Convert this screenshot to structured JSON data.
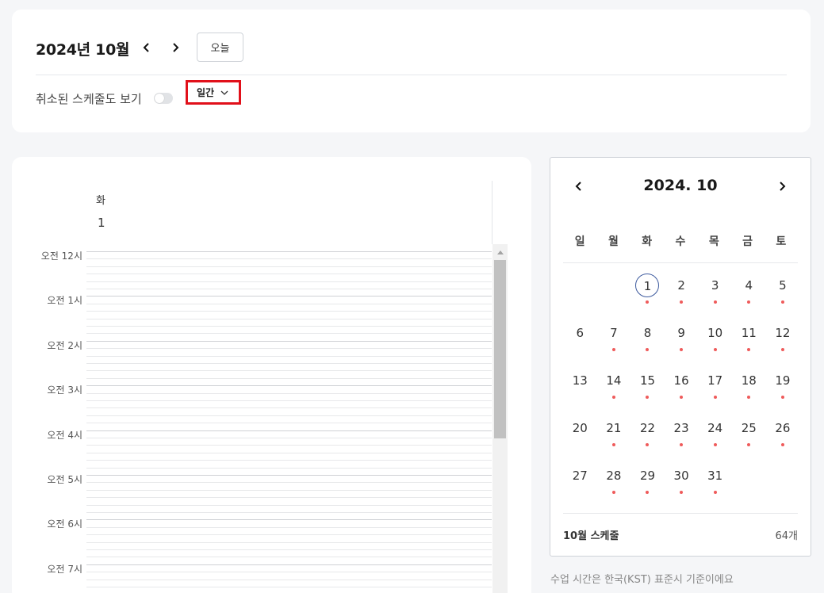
{
  "header": {
    "month_title": "2024년 10월",
    "today_label": "오늘",
    "show_cancelled_label": "취소된 스케줄도 보기",
    "view_select_value": "일간"
  },
  "day_view": {
    "weekday": "화",
    "date": "1",
    "time_labels": [
      "오전 12시",
      "오전 1시",
      "오전 2시",
      "오전 3시",
      "오전 4시",
      "오전 5시",
      "오전 6시",
      "오전 7시"
    ]
  },
  "mini_calendar": {
    "title": "2024. 10",
    "weekdays": [
      "일",
      "월",
      "화",
      "수",
      "목",
      "금",
      "토"
    ],
    "first_weekday_index": 2,
    "days": [
      {
        "d": "1",
        "dot": true,
        "today": true
      },
      {
        "d": "2",
        "dot": true
      },
      {
        "d": "3",
        "dot": true
      },
      {
        "d": "4",
        "dot": true
      },
      {
        "d": "5",
        "dot": true
      },
      {
        "d": "6",
        "dot": false
      },
      {
        "d": "7",
        "dot": true
      },
      {
        "d": "8",
        "dot": true
      },
      {
        "d": "9",
        "dot": true
      },
      {
        "d": "10",
        "dot": true
      },
      {
        "d": "11",
        "dot": true
      },
      {
        "d": "12",
        "dot": true
      },
      {
        "d": "13",
        "dot": false
      },
      {
        "d": "14",
        "dot": true
      },
      {
        "d": "15",
        "dot": true
      },
      {
        "d": "16",
        "dot": true
      },
      {
        "d": "17",
        "dot": true
      },
      {
        "d": "18",
        "dot": true
      },
      {
        "d": "19",
        "dot": true
      },
      {
        "d": "20",
        "dot": false
      },
      {
        "d": "21",
        "dot": true
      },
      {
        "d": "22",
        "dot": true
      },
      {
        "d": "23",
        "dot": true
      },
      {
        "d": "24",
        "dot": true
      },
      {
        "d": "25",
        "dot": true
      },
      {
        "d": "26",
        "dot": true
      },
      {
        "d": "27",
        "dot": false
      },
      {
        "d": "28",
        "dot": true
      },
      {
        "d": "29",
        "dot": true
      },
      {
        "d": "30",
        "dot": true
      },
      {
        "d": "31",
        "dot": true
      }
    ],
    "footer_label": "10월 스케줄",
    "footer_count": "64개"
  },
  "timezone_note": "수업 시간은 한국(KST) 표준시 기준이에요",
  "colors": {
    "highlight_border": "#e1101a",
    "event_dot": "#ef5b5b",
    "today_ring": "#3d5a9e"
  }
}
